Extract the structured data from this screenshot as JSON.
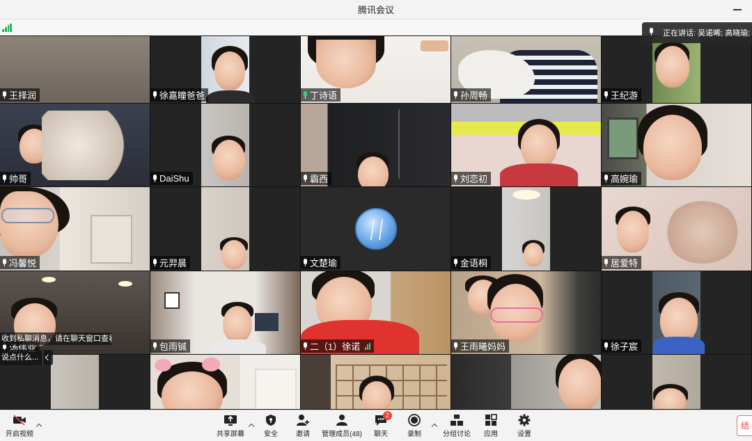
{
  "window": {
    "title": "腾讯会议"
  },
  "speaking": {
    "label": "正在讲话: 吴诺晞; 高晓瑜;"
  },
  "participants": [
    {
      "name": "王择润"
    },
    {
      "name": "徐嘉瞳爸爸"
    },
    {
      "name": "丁诗语"
    },
    {
      "name": "孙周畅"
    },
    {
      "name": "王纪游"
    },
    {
      "name": "帅哥"
    },
    {
      "name": "DaiShu"
    },
    {
      "name": "霸西"
    },
    {
      "name": "刘恋初"
    },
    {
      "name": "高婉瑜"
    },
    {
      "name": "冯馨悦"
    },
    {
      "name": "元羿晨"
    },
    {
      "name": "文楚瑜"
    },
    {
      "name": "金语桐"
    },
    {
      "name": "居爱特"
    },
    {
      "name": "汤伟业"
    },
    {
      "name": "包雨铖"
    },
    {
      "name": "二（1）徐诺"
    },
    {
      "name": "王雨曦妈妈"
    },
    {
      "name": "徐子宸"
    }
  ],
  "chat": {
    "toast": "收到私聊消息，请在聊天窗口查看",
    "preview": "说点什么..."
  },
  "toolbar": {
    "video": "开启视频",
    "share": "共享屏幕",
    "security": "安全",
    "invite": "邀请",
    "members": "管理成员(48)",
    "chat": "聊天",
    "chat_badge": "2",
    "record": "录制",
    "breakout": "分组讨论",
    "apps": "应用",
    "settings": "设置",
    "end": "结"
  }
}
